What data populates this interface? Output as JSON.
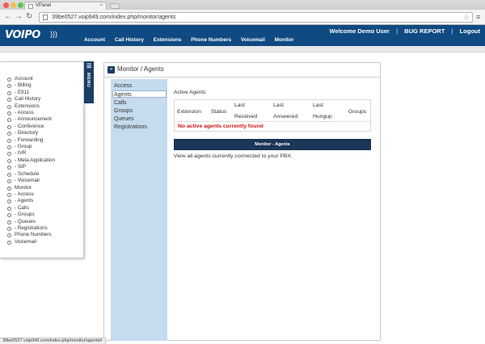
{
  "browser": {
    "tab_title": "VPanel",
    "tab_close": "×",
    "url": "39be0527.voip949.com/index.php/monitor/agents",
    "status_url": "39be0527.voip949.com/index.php/monitor/agents#",
    "back": "←",
    "forward": "→",
    "reload": "↻",
    "star": "☆",
    "menu": "≡"
  },
  "header": {
    "logo": "VOIPO",
    "welcome": "Welcome Demo User",
    "bug_report": "BUG REPORT",
    "separator": "|",
    "logout": "Logout",
    "nav": [
      "Account",
      "Call History",
      "Extensions",
      "Phone Numbers",
      "Voicemail",
      "Monitor"
    ],
    "color": "#0f4a82"
  },
  "side_menu": {
    "tab_label": "MENU",
    "items": [
      {
        "label": "Account",
        "level": 0
      },
      {
        "label": "- Billing",
        "level": 1
      },
      {
        "label": "- E911",
        "level": 1
      },
      {
        "label": "Call History",
        "level": 0
      },
      {
        "label": "Extensions",
        "level": 0
      },
      {
        "label": "- Access",
        "level": 1
      },
      {
        "label": "- Announcement",
        "level": 1
      },
      {
        "label": "- Conference",
        "level": 1
      },
      {
        "label": "- Directory",
        "level": 1
      },
      {
        "label": "- Forwarding",
        "level": 1
      },
      {
        "label": "- Group",
        "level": 1
      },
      {
        "label": "- IVR",
        "level": 1
      },
      {
        "label": "- Meta Application",
        "level": 1
      },
      {
        "label": "- SIP",
        "level": 1
      },
      {
        "label": "- Schedule",
        "level": 1
      },
      {
        "label": "- Voicemail",
        "level": 1
      },
      {
        "label": "Monitor",
        "level": 0
      },
      {
        "label": "- Access",
        "level": 1
      },
      {
        "label": "- Agents",
        "level": 1
      },
      {
        "label": "- Calls",
        "level": 1
      },
      {
        "label": "- Groups",
        "level": 1
      },
      {
        "label": "- Queues",
        "level": 1
      },
      {
        "label": "- Registrations",
        "level": 1
      },
      {
        "label": "Phone Numbers",
        "level": 0
      },
      {
        "label": "Voicemail",
        "level": 0
      }
    ]
  },
  "page": {
    "breadcrumb_icon": "»",
    "breadcrumb": "Monitor / Agents",
    "subnav": [
      "Access",
      "Agents",
      "Calls",
      "Groups",
      "Queues",
      "Registrations"
    ],
    "active_subnav": "Agents",
    "section_title": "Active Agents",
    "table": {
      "headers": [
        {
          "line1": "Extension",
          "line2": ""
        },
        {
          "line1": "Status",
          "line2": ""
        },
        {
          "line1": "Last",
          "line2": "Received"
        },
        {
          "line1": "Last",
          "line2": "Answered"
        },
        {
          "line1": "Last",
          "line2": "Hungup"
        },
        {
          "line1": "Groups",
          "line2": ""
        }
      ],
      "empty_message": "No active agents currently found"
    },
    "banner": "Monitor - Agents",
    "description": "View all agents currently connected to your PBX."
  }
}
